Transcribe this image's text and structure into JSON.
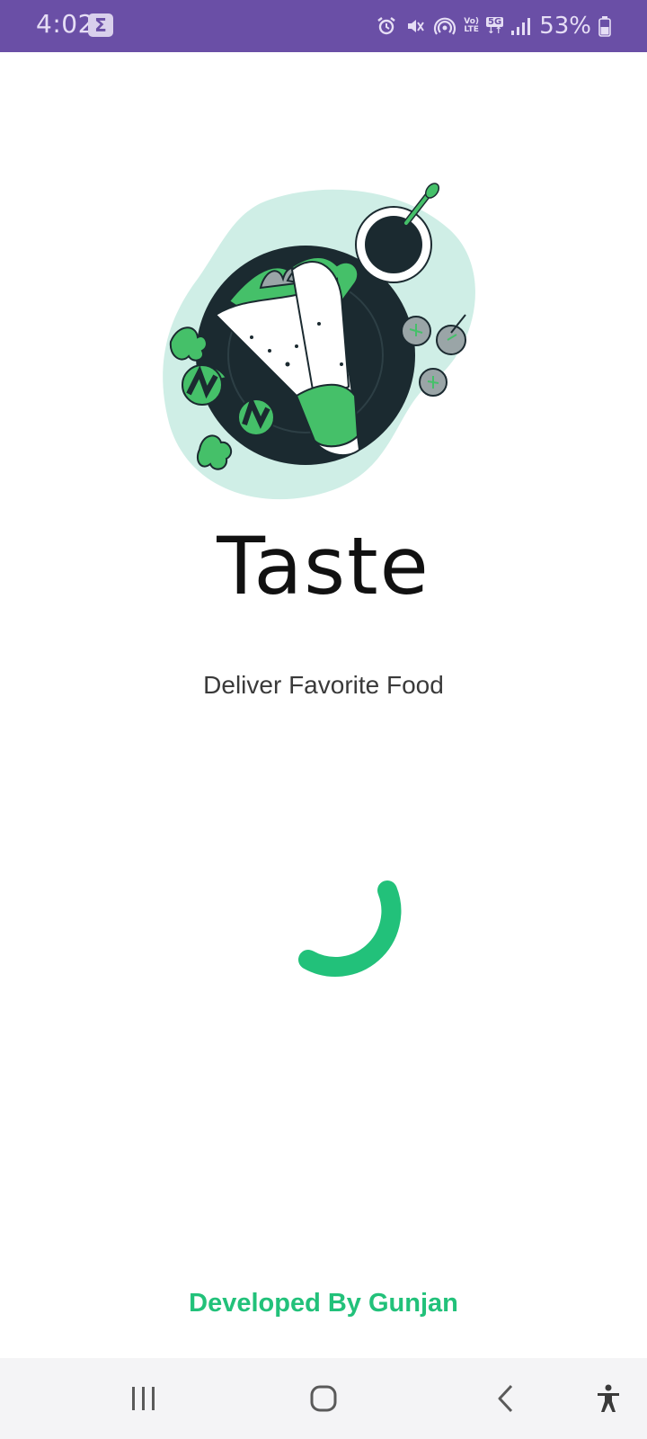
{
  "status_bar": {
    "time": "4:02",
    "sigma_icon": "sigma-notification-icon",
    "icons": [
      "alarm-icon",
      "mute-icon",
      "hotspot-icon",
      "volte-icon",
      "5g-icon",
      "signal-icon"
    ],
    "volte_line1": "Vo)",
    "volte_line2": "LTE",
    "network_label": "5G",
    "battery_percent": "53%"
  },
  "splash": {
    "illustration_icon": "burrito-wrap-illustration",
    "title": "Taste",
    "tagline": "Deliver Favorite Food",
    "spinner_icon": "loading-spinner",
    "credit": "Developed By Gunjan"
  },
  "colors": {
    "status_bar_bg": "#6a4fa6",
    "accent_green": "#22c17a",
    "plate_dark": "#1b2a30",
    "blob_mint": "#cfeee6"
  },
  "nav_bar": {
    "buttons": [
      "recent-apps-icon",
      "home-icon",
      "back-icon",
      "accessibility-icon"
    ]
  }
}
